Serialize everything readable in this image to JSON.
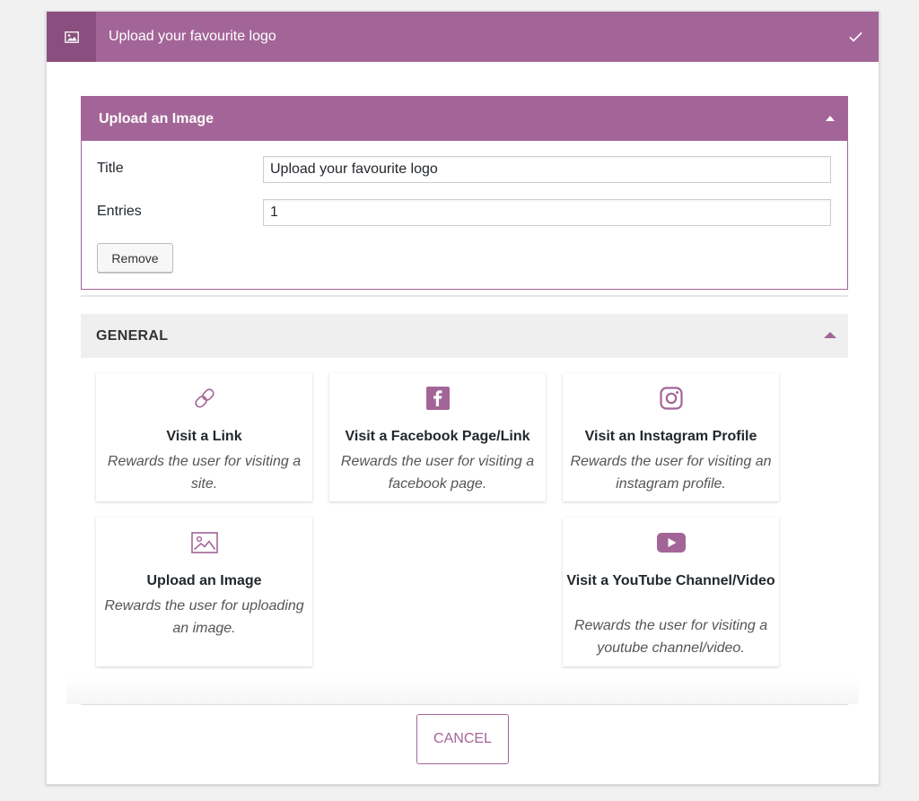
{
  "header": {
    "title": "Upload your favourite logo",
    "icon": "image-icon",
    "status_icon": "checkmark-icon"
  },
  "upload_section": {
    "heading": "Upload an Image",
    "fields": {
      "title_label": "Title",
      "title_value": "Upload your favourite logo",
      "entries_label": "Entries",
      "entries_value": "1"
    },
    "remove_label": "Remove"
  },
  "general": {
    "heading": "GENERAL",
    "cards": [
      {
        "icon": "link-icon",
        "title": "Visit a Link",
        "desc": "Rewards the user for visiting a site."
      },
      {
        "icon": "facebook-icon",
        "title": "Visit a Facebook Page/Link",
        "desc": "Rewards the user for visiting a facebook page."
      },
      {
        "icon": "instagram-icon",
        "title": "Visit an Instagram Profile",
        "desc": "Rewards the user for visiting an instagram profile."
      },
      {
        "icon": "image-icon",
        "title": "Upload an Image",
        "desc": "Rewards the user for uploading an image."
      },
      {
        "icon": "youtube-icon",
        "title": "Visit a YouTube Channel/Video",
        "desc": "Rewards the user for visiting a youtube channel/video."
      }
    ]
  },
  "footer": {
    "cancel_label": "CANCEL"
  },
  "colors": {
    "accent": "#a36597",
    "accent_dark": "#8a4f7e",
    "general_bg": "#efefef"
  }
}
